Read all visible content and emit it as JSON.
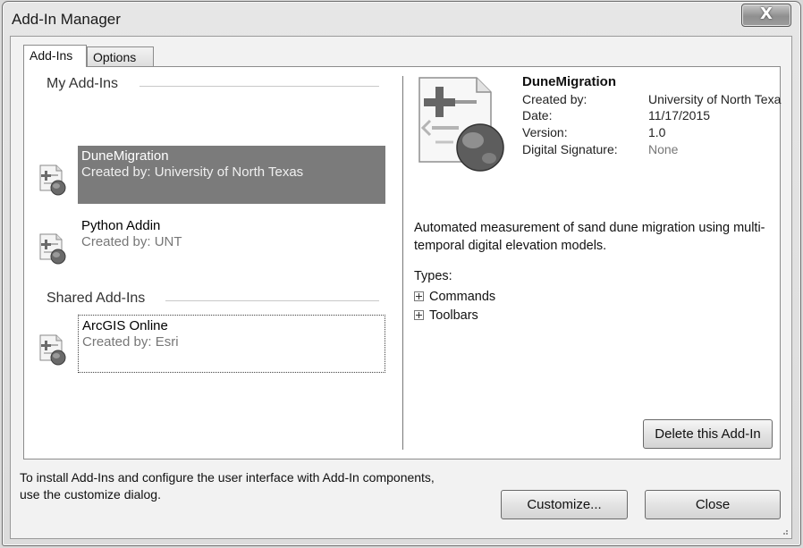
{
  "window": {
    "title": "Add-In Manager",
    "close_glyph": "X"
  },
  "tabs": [
    {
      "label": "Add-Ins",
      "active": true
    },
    {
      "label": "Options",
      "active": false
    }
  ],
  "my_addins": {
    "header": "My Add-Ins",
    "items": [
      {
        "name": "DuneMigration",
        "created_by": "Created by: University of North Texas",
        "selected": true,
        "icon": "addin-globe-icon"
      },
      {
        "name": "Python Addin",
        "created_by": "Created by: UNT",
        "selected": false,
        "icon": "addin-globe-icon"
      }
    ]
  },
  "shared_addins": {
    "header": "Shared Add-Ins",
    "items": [
      {
        "name": "ArcGIS Online",
        "created_by": "Created by: Esri",
        "focused": true,
        "icon": "addin-globe-icon"
      }
    ]
  },
  "details": {
    "name": "DuneMigration",
    "fields": [
      {
        "label": "Created by:",
        "value": "University of North Texa"
      },
      {
        "label": "Date:",
        "value": "11/17/2015"
      },
      {
        "label": "Version:",
        "value": "1.0"
      },
      {
        "label": "Digital Signature:",
        "value": "None"
      }
    ],
    "description": "Automated measurement of sand dune migration using multi-temporal digital elevation models.",
    "types_label": "Types:",
    "types": [
      "Commands",
      "Toolbars"
    ],
    "delete_button": "Delete this Add-In"
  },
  "footer": {
    "hint": "To install Add-Ins and configure the user interface with Add-In components, use the customize dialog.",
    "customize_button": "Customize...",
    "close_button": "Close"
  }
}
